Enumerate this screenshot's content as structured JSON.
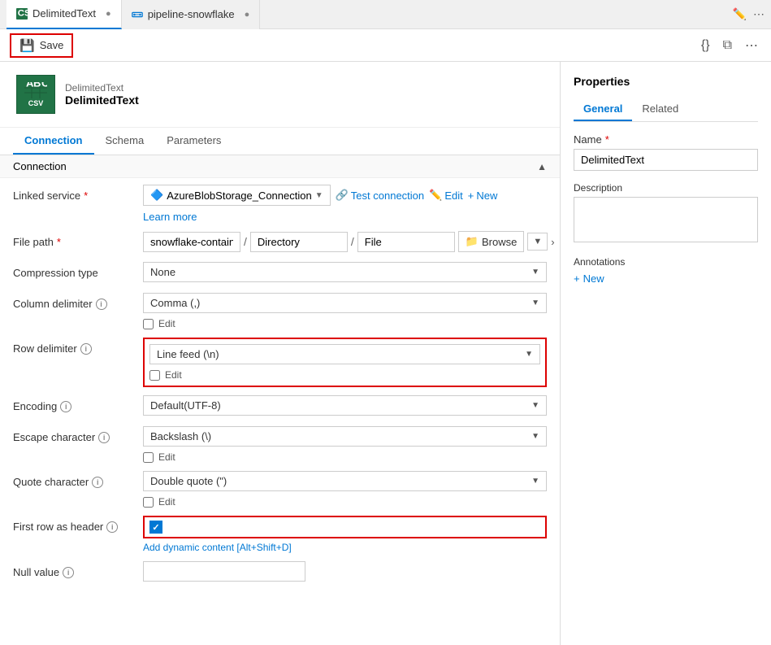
{
  "tabs": [
    {
      "id": "delimited",
      "label": "DelimitedText",
      "icon": "csv",
      "active": true
    },
    {
      "id": "pipeline",
      "label": "pipeline-snowflake",
      "icon": "pipeline",
      "active": false
    }
  ],
  "toolbar": {
    "save_label": "Save",
    "right_icons": [
      "{}",
      "copy",
      "more"
    ]
  },
  "dataset": {
    "type_label": "DelimitedText",
    "name": "DelimitedText"
  },
  "section_tabs": [
    {
      "id": "connection",
      "label": "Connection",
      "active": true
    },
    {
      "id": "schema",
      "label": "Schema",
      "active": false
    },
    {
      "id": "parameters",
      "label": "Parameters",
      "active": false
    }
  ],
  "connection_section": {
    "toggle_label": "Connection",
    "linked_service": {
      "label": "Linked service",
      "required": true,
      "value": "AzureBlobStorage_Connection",
      "actions": [
        "Test connection",
        "Edit",
        "New",
        "Learn more"
      ]
    },
    "file_path": {
      "label": "File path",
      "required": true,
      "container": "snowflake-container",
      "directory": "Directory",
      "file": "File",
      "browse_label": "Browse"
    },
    "compression_type": {
      "label": "Compression type",
      "value": "None"
    },
    "column_delimiter": {
      "label": "Column delimiter",
      "info": true,
      "value": "Comma (,)",
      "edit_label": "Edit"
    },
    "row_delimiter": {
      "label": "Row delimiter",
      "info": true,
      "value": "Line feed (\\n)",
      "edit_label": "Edit",
      "highlighted": true
    },
    "encoding": {
      "label": "Encoding",
      "info": true,
      "value": "Default(UTF-8)"
    },
    "escape_character": {
      "label": "Escape character",
      "info": true,
      "value": "Backslash (\\)",
      "edit_label": "Edit"
    },
    "quote_character": {
      "label": "Quote character",
      "info": true,
      "value": "Double quote (\")",
      "edit_label": "Edit"
    },
    "first_row_header": {
      "label": "First row as header",
      "info": true,
      "checked": true,
      "dynamic_content": "Add dynamic content [Alt+Shift+D]",
      "highlighted": true
    },
    "null_value": {
      "label": "Null value",
      "info": true,
      "value": ""
    }
  },
  "properties": {
    "title": "Properties",
    "tabs": [
      {
        "id": "general",
        "label": "General",
        "active": true
      },
      {
        "id": "related",
        "label": "Related",
        "active": false
      }
    ],
    "name_label": "Name",
    "name_required": true,
    "name_value": "DelimitedText",
    "description_label": "Description",
    "description_value": "",
    "annotations_label": "Annotations",
    "add_new_label": "New"
  }
}
